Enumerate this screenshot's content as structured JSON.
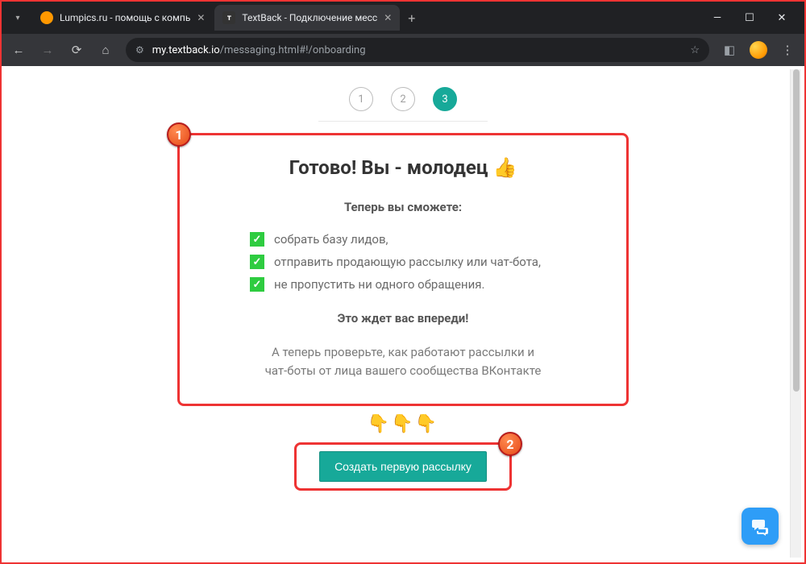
{
  "browser": {
    "tabs": [
      {
        "title": "Lumpics.ru - помощь с компь",
        "favicon_bg": "#ff9800"
      },
      {
        "title": "TextBack - Подключение месс",
        "favicon_bg": "#333"
      }
    ],
    "url_domain": "my.textback.io",
    "url_path": "/messaging.html#!/onboarding"
  },
  "stepper": {
    "steps": [
      "1",
      "2",
      "3"
    ],
    "active_index": 2
  },
  "card": {
    "title": "Готово! Вы - молодец",
    "title_emoji": "👍",
    "subhead": "Теперь вы сможете:",
    "items": [
      "собрать базу лидов,",
      "отправить продающую рассылку или чат-бота,",
      "не пропустить ни одного обращения."
    ],
    "ahead": "Это ждет вас впереди!",
    "try_line1": "А теперь проверьте, как работают рассылки и",
    "try_line2": "чат-боты от лица вашего сообщества ВКонтакте"
  },
  "pointers_emoji": "👇👇👇",
  "cta_label": "Создать первую рассылку",
  "callouts": {
    "one": "1",
    "two": "2"
  }
}
